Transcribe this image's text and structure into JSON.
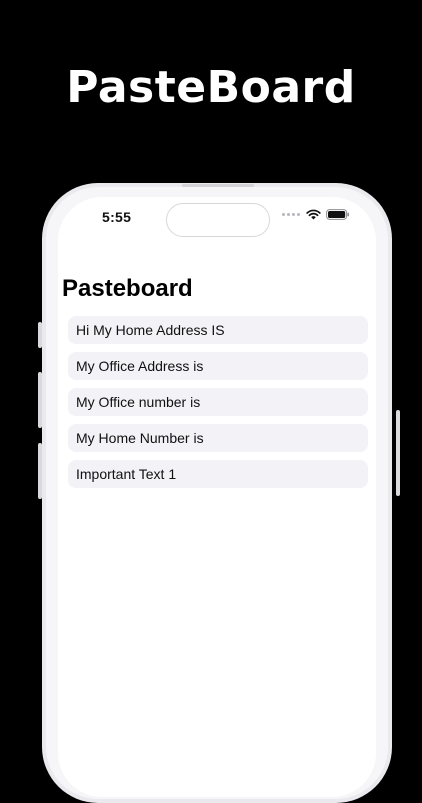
{
  "promo": {
    "title": "PasteBoard"
  },
  "status_bar": {
    "time": "5:55",
    "icons": [
      "cellular-dots-icon",
      "wifi-icon",
      "battery-icon"
    ]
  },
  "page": {
    "title": "Pasteboard"
  },
  "items": [
    {
      "label": "Hi My Home Address IS"
    },
    {
      "label": "My Office Address is"
    },
    {
      "label": "My Office number is"
    },
    {
      "label": "My Home Number is"
    },
    {
      "label": "Important Text 1"
    }
  ],
  "colors": {
    "background": "#000000",
    "promo_text": "#ffffff",
    "list_item_background": "#f2f2f7",
    "phone_frame": "#e9e9ee"
  }
}
